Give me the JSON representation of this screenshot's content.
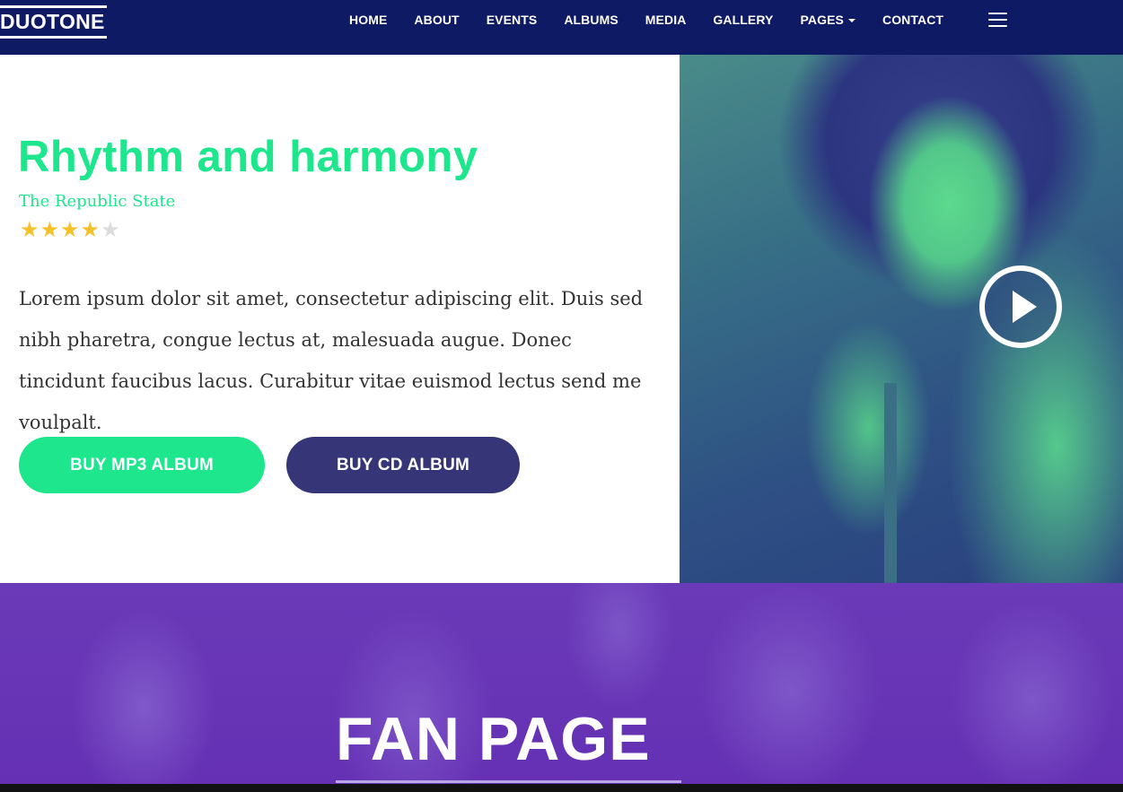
{
  "brand": {
    "logo": "DUOTONE"
  },
  "nav": {
    "items": [
      {
        "label": "HOME"
      },
      {
        "label": "ABOUT"
      },
      {
        "label": "EVENTS"
      },
      {
        "label": "ALBUMS"
      },
      {
        "label": "MEDIA"
      },
      {
        "label": "GALLERY"
      },
      {
        "label": "PAGES",
        "dropdown": true
      },
      {
        "label": "CONTACT"
      }
    ],
    "menu_icon": "hamburger-icon"
  },
  "hero": {
    "title": "Rhythm and harmony",
    "subtitle": "The Republic State",
    "rating": {
      "value": 4,
      "max": 5
    },
    "description": "Lorem ipsum dolor sit amet, consectetur adipiscing elit. Duis sed nibh pharetra, congue lectus at, malesuada augue. Donec tincidunt faucibus lacus. Curabitur vitae euismod lectus send me voulpalt.",
    "buttons": {
      "mp3": "BUY MP3 ALBUM",
      "cd": "BUY CD ALBUM"
    },
    "media_icon": "play-icon"
  },
  "fan_section": {
    "title": "FAN PAGE"
  },
  "colors": {
    "nav_bg": "#0f1a64",
    "accent_green": "#1de68d",
    "button_navy": "#353577",
    "fan_purple": "#6530b4",
    "star_on": "#f6c22b",
    "star_off": "#dcdcdc"
  }
}
